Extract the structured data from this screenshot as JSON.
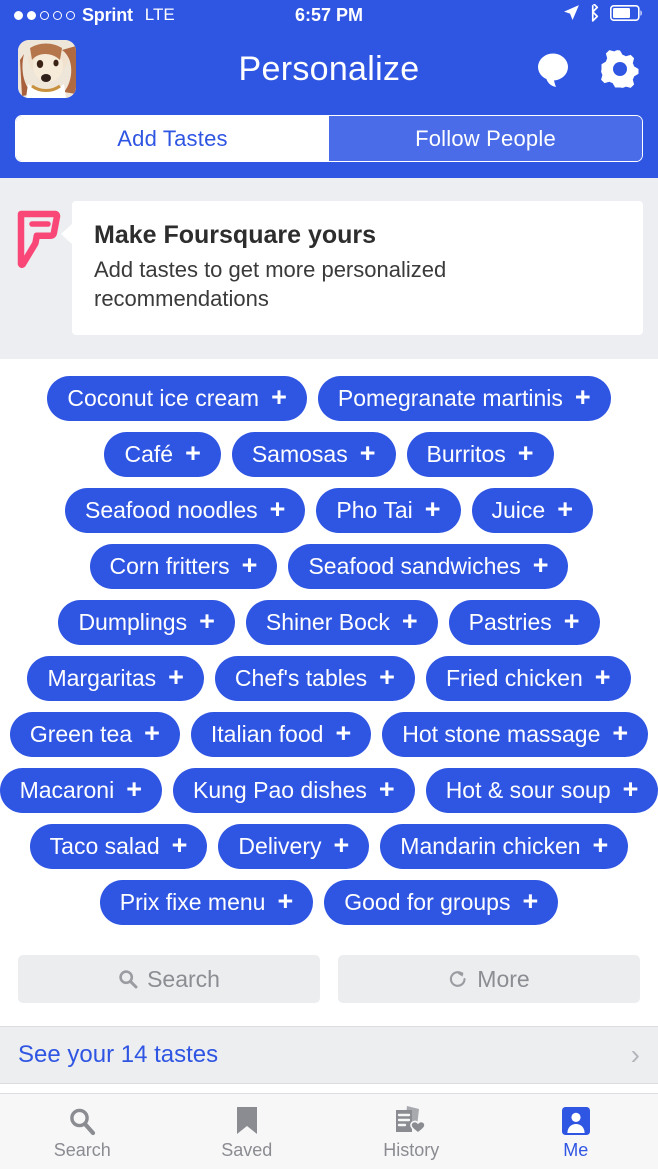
{
  "status_bar": {
    "signal_dots_filled": 2,
    "signal_dots_total": 5,
    "carrier": "Sprint",
    "network": "LTE",
    "time": "6:57 PM",
    "icons": [
      "location-arrow-icon",
      "bluetooth-icon",
      "battery-icon"
    ]
  },
  "nav": {
    "title": "Personalize",
    "avatar_alt": "user-avatar-dog",
    "messages_icon": "chat-bubble-icon",
    "settings_icon": "gear-icon"
  },
  "segment": {
    "tabs": [
      {
        "label": "Add Tastes",
        "selected": true
      },
      {
        "label": "Follow People",
        "selected": false
      }
    ]
  },
  "banner": {
    "logo_icon": "foursquare-logo-icon",
    "title": "Make Foursquare yours",
    "subtitle": "Add tastes to get more personalized recommendations"
  },
  "tastes": {
    "add_glyph": "+",
    "rows": [
      [
        "Coconut ice cream",
        "Pomegranate martinis"
      ],
      [
        "Café",
        "Samosas",
        "Burritos"
      ],
      [
        "Seafood noodles",
        "Pho Tai",
        "Juice"
      ],
      [
        "Corn fritters",
        "Seafood sandwiches"
      ],
      [
        "Dumplings",
        "Shiner Bock",
        "Pastries"
      ],
      [
        "Margaritas",
        "Chef's tables",
        "Fried chicken"
      ],
      [
        "Green tea",
        "Italian food",
        "Hot stone massage"
      ],
      [
        "Macaroni",
        "Kung Pao dishes",
        "Hot & sour soup"
      ],
      [
        "Taco salad",
        "Delivery",
        "Mandarin chicken"
      ],
      [
        "Prix fixe menu",
        "Good for groups"
      ]
    ]
  },
  "actions": {
    "search": {
      "label": "Search",
      "icon": "search-icon"
    },
    "more": {
      "label": "More",
      "icon": "refresh-icon"
    }
  },
  "see_tastes": {
    "label": "See your 14 tastes",
    "count": 14,
    "chevron": "›"
  },
  "tabbar": {
    "items": [
      {
        "label": "Search",
        "icon": "search-icon",
        "active": false
      },
      {
        "label": "Saved",
        "icon": "bookmark-icon",
        "active": false
      },
      {
        "label": "History",
        "icon": "history-receipt-heart-icon",
        "active": false
      },
      {
        "label": "Me",
        "icon": "person-badge-icon",
        "active": true
      }
    ]
  },
  "colors": {
    "brand_blue": "#2f55e3",
    "segment_inactive": "#4a6ce8",
    "banner_bg": "#eceef1",
    "foursquare_pink": "#f94877",
    "muted_gray": "#8a8c91",
    "action_bg": "#ecedef"
  }
}
